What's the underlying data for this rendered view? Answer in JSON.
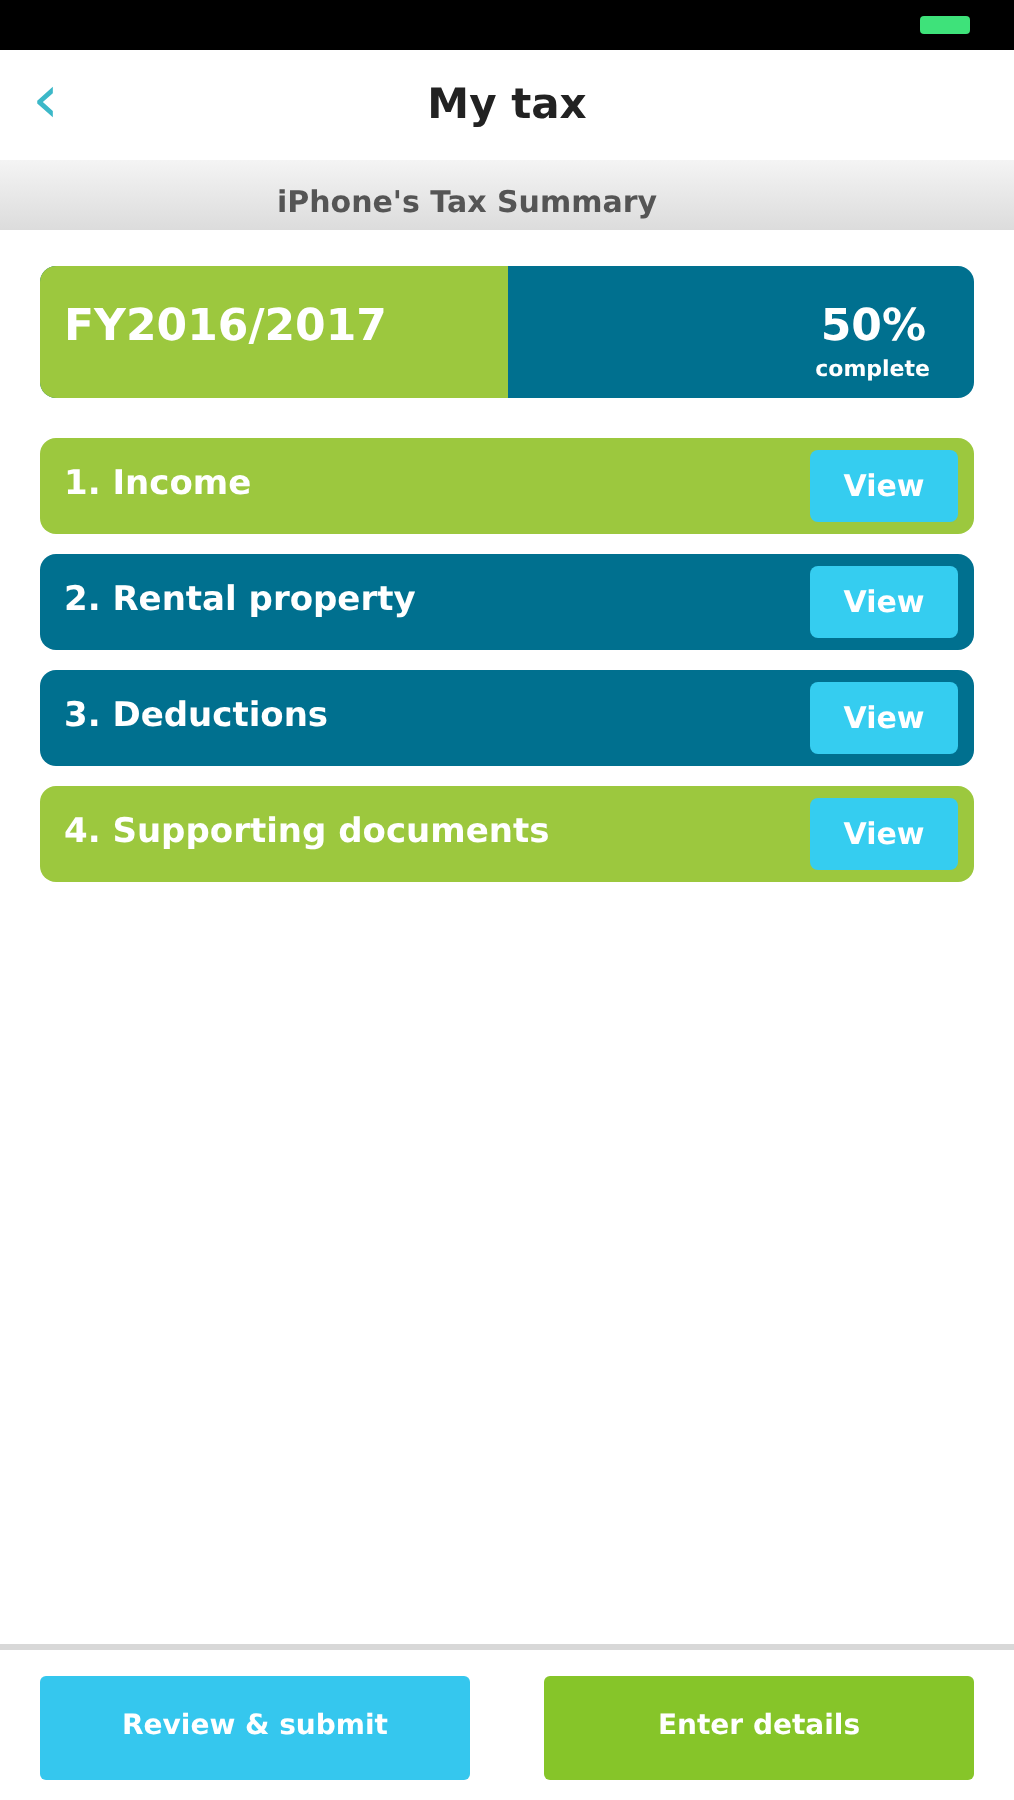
{
  "nav": {
    "back": "‹",
    "title": "My tax"
  },
  "subheader": "iPhone's Tax Summary",
  "progress": {
    "year": "FY2016/2017",
    "percent": "50%",
    "caption": "complete",
    "level": 0.5
  },
  "sections": [
    {
      "label": "1. Income",
      "complete": true,
      "button": "View"
    },
    {
      "label": "2. Rental property",
      "complete": false,
      "button": "View"
    },
    {
      "label": "3. Deductions",
      "complete": false,
      "button": "View"
    },
    {
      "label": "4. Supporting documents",
      "complete": true,
      "button": "View"
    }
  ],
  "actions": [
    {
      "label": "Review & submit",
      "kind": "secondary"
    },
    {
      "label": "Enter details",
      "kind": "primary"
    }
  ]
}
